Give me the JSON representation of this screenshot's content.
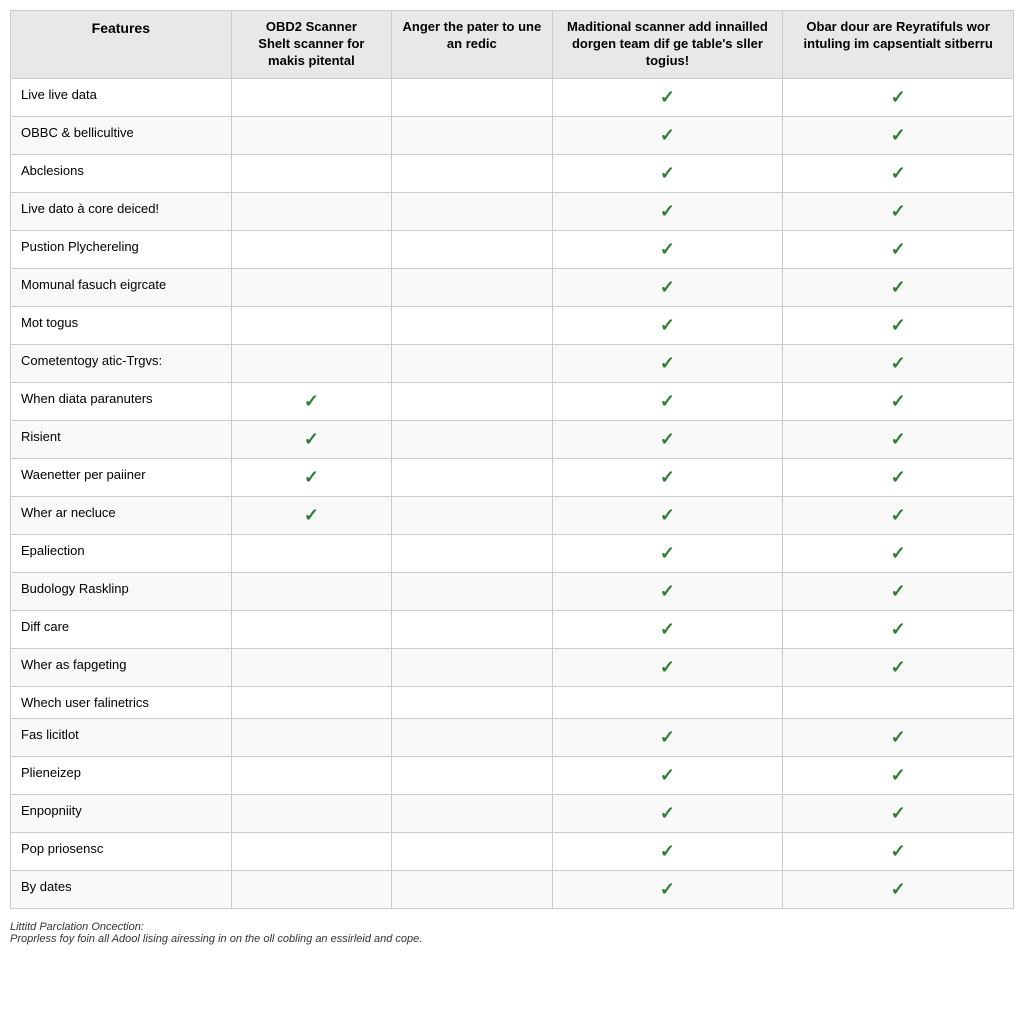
{
  "table": {
    "headers": [
      {
        "id": "features",
        "label": "Features"
      },
      {
        "id": "col2",
        "label": "OBD2 Scanner\nShelt scanner for makis pitental"
      },
      {
        "id": "col3",
        "label": "Anger the pater to une an redic"
      },
      {
        "id": "col4",
        "label": "Maditional scanner add innailled dorgen team dif ge table's sller togius!"
      },
      {
        "id": "col5",
        "label": "Obar dour are Reyratifuls wor intuling im capsentialt sitberru"
      }
    ],
    "rows": [
      {
        "feature": "Live live data",
        "col2": false,
        "col3": false,
        "col4": true,
        "col5": true
      },
      {
        "feature": "OBBC & bellicultive",
        "col2": false,
        "col3": false,
        "col4": true,
        "col5": true
      },
      {
        "feature": "Abclesions",
        "col2": false,
        "col3": false,
        "col4": true,
        "col5": true
      },
      {
        "feature": "Live dato à core deiced!",
        "col2": false,
        "col3": false,
        "col4": true,
        "col5": true
      },
      {
        "feature": "Pustion Plychereling",
        "col2": false,
        "col3": false,
        "col4": true,
        "col5": true
      },
      {
        "feature": "Momunal fasuch eigrcate",
        "col2": false,
        "col3": false,
        "col4": true,
        "col5": true
      },
      {
        "feature": "Mot togus",
        "col2": false,
        "col3": false,
        "col4": true,
        "col5": true
      },
      {
        "feature": "Cometentogy atic-Trgvs:",
        "col2": false,
        "col3": false,
        "col4": true,
        "col5": true
      },
      {
        "feature": "When diata paranuters",
        "col2": true,
        "col3": false,
        "col4": true,
        "col5": true
      },
      {
        "feature": "Risient",
        "col2": true,
        "col3": false,
        "col4": true,
        "col5": true
      },
      {
        "feature": "Waenetter per paiiner",
        "col2": true,
        "col3": false,
        "col4": true,
        "col5": true
      },
      {
        "feature": "Wher ar necluce",
        "col2": true,
        "col3": false,
        "col4": true,
        "col5": true
      },
      {
        "feature": "Epaliection",
        "col2": false,
        "col3": false,
        "col4": true,
        "col5": true
      },
      {
        "feature": "Budology Rasklinp",
        "col2": false,
        "col3": false,
        "col4": true,
        "col5": true
      },
      {
        "feature": "Diff care",
        "col2": false,
        "col3": false,
        "col4": true,
        "col5": true
      },
      {
        "feature": "Wher as fapgeting",
        "col2": false,
        "col3": false,
        "col4": true,
        "col5": true
      },
      {
        "feature": "Whech user falinetrics",
        "col2": false,
        "col3": false,
        "col4": false,
        "col5": false
      },
      {
        "feature": "Fas licitlot",
        "col2": false,
        "col3": false,
        "col4": true,
        "col5": true
      },
      {
        "feature": "Plieneizep",
        "col2": false,
        "col3": false,
        "col4": true,
        "col5": true
      },
      {
        "feature": "Enpopniity",
        "col2": false,
        "col3": false,
        "col4": true,
        "col5": true
      },
      {
        "feature": "Pop priosensc",
        "col2": false,
        "col3": false,
        "col4": true,
        "col5": true
      },
      {
        "feature": "By dates",
        "col2": false,
        "col3": false,
        "col4": true,
        "col5": true
      }
    ],
    "check_symbol": "✓",
    "footer": {
      "line1": "Littitd Parclation Oncection:",
      "line2": "Proprless foy foin all Adool lising airessing in on the oll cobling an essirleid and cope."
    }
  }
}
